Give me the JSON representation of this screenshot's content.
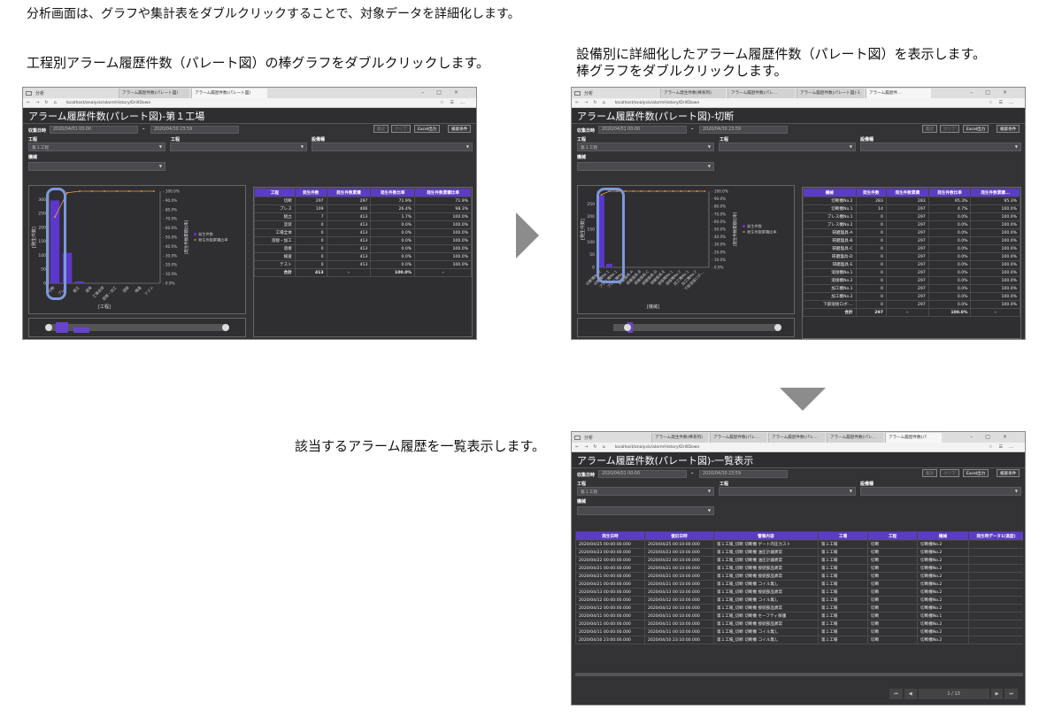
{
  "captions": {
    "top": "分析画面は、グラフや集計表をダブルクリックすることで、対象データを詳細化します。",
    "left": "工程別アラーム履歴件数（パレート図）の棒グラフをダブルクリックします。",
    "right_line1": "設備別に詳細化したアラーム履歴件数（パレート図）を表示します。",
    "right_line2": "棒グラフをダブルクリックします。",
    "bottom": "該当するアラーム履歴を一覧表示します。"
  },
  "browser": {
    "url": "localhost/analysis/alarmHistory/DrillDown",
    "start_label": "分析",
    "tabs1": [
      "アラーム履歴件数(パレート図)",
      "アラーム履歴件数(パレート図)"
    ],
    "tabs2": [
      "アラーム発生件数(棒系列)",
      "アラーム履歴件数(パレ...",
      "アラーム履歴件数(パレート図)-1",
      "アラーム履歴件..."
    ],
    "tabs3": [
      "アラーム発生件数(棒系列)",
      "アラーム履歴件数(パレ...",
      "アラーム履歴件数(パレ...",
      "アラーム履歴件数(パレ...",
      "アラーム履歴件数(パ"
    ]
  },
  "filters": {
    "date_label": "収集日時",
    "date_from": "2020/04/01 00:00",
    "date_to": "2020/04/30 23:59",
    "process_label": "工程",
    "process_value": "第１工程",
    "step_label": "工程",
    "equipment_type_label": "設備種",
    "equipment_label": "機械",
    "buttons": {
      "aggregate": "集計",
      "clear": "クリア",
      "excel": "Excel出力",
      "search": "検索条件"
    }
  },
  "screen1": {
    "title": "アラーム履歴件数(パレート図)-第１工場",
    "xlabel": "[工程]",
    "ylabel": "[発生件数]",
    "right_axis_label": "[発生件数累積比率]",
    "legend": [
      "発生件数",
      "発生件数累積比率"
    ],
    "table_headers": [
      "工程",
      "発生件数",
      "発生件数累積",
      "発生件数比率",
      "発生件数累積比率"
    ],
    "rows": [
      [
        "切断",
        "297",
        "297",
        "71.9%",
        "71.9%"
      ],
      [
        "プレス",
        "109",
        "406",
        "26.4%",
        "98.3%"
      ],
      [
        "組立",
        "7",
        "413",
        "1.7%",
        "100.0%"
      ],
      [
        "塗装",
        "0",
        "413",
        "0.0%",
        "100.0%"
      ],
      [
        "工場全体",
        "0",
        "413",
        "0.0%",
        "100.0%"
      ],
      [
        "溶接・加工",
        "0",
        "413",
        "0.0%",
        "100.0%"
      ],
      [
        "溶接",
        "0",
        "413",
        "0.0%",
        "100.0%"
      ],
      [
        "検査",
        "0",
        "413",
        "0.0%",
        "100.0%"
      ],
      [
        "テスト",
        "0",
        "413",
        "0.0%",
        "100.0%"
      ]
    ],
    "total": [
      "合計",
      "413",
      "-",
      "100.0%",
      "-"
    ]
  },
  "screen2": {
    "title": "アラーム履歴件数(パレート図)-切断",
    "xlabel": "[機械]",
    "ylabel": "[発生件数]",
    "right_axis_label": "[発生件数累積比率]",
    "legend": [
      "発生件数",
      "発生件数累積比率"
    ],
    "table_headers": [
      "機械",
      "発生件数",
      "発生件数累積",
      "発生件数比率",
      "発生件数累積..."
    ],
    "rows": [
      [
        "切断機No.2",
        "283",
        "283",
        "95.3%",
        "95.3%"
      ],
      [
        "切断機No.1",
        "14",
        "297",
        "4.7%",
        "100.0%"
      ],
      [
        "プレス機No.1",
        "0",
        "297",
        "0.0%",
        "100.0%"
      ],
      [
        "プレス機No.2",
        "0",
        "297",
        "0.0%",
        "100.0%"
      ],
      [
        "研磨盤具-A",
        "0",
        "297",
        "0.0%",
        "100.0%"
      ],
      [
        "研磨盤具-B",
        "0",
        "297",
        "0.0%",
        "100.0%"
      ],
      [
        "研磨盤具-C",
        "0",
        "297",
        "0.0%",
        "100.0%"
      ],
      [
        "研磨盤具-D",
        "0",
        "297",
        "0.0%",
        "100.0%"
      ],
      [
        "研磨盤具-E",
        "0",
        "297",
        "0.0%",
        "100.0%"
      ],
      [
        "溶接機No.1",
        "0",
        "297",
        "0.0%",
        "100.0%"
      ],
      [
        "溶接機No.2",
        "0",
        "297",
        "0.0%",
        "100.0%"
      ],
      [
        "加工機No.1",
        "0",
        "297",
        "0.0%",
        "100.0%"
      ],
      [
        "加工機No.2",
        "0",
        "297",
        "0.0%",
        "100.0%"
      ],
      [
        "下部溶接ロボ-...",
        "0",
        "297",
        "0.0%",
        "100.0%"
      ]
    ],
    "total": [
      "合計",
      "297",
      "-",
      "100.0%",
      "-"
    ]
  },
  "screen3": {
    "title": "アラーム履歴件数(パレート図)-一覧表示",
    "table_headers": [
      "発生日時",
      "復旧日時",
      "警報内容",
      "工場",
      "工程",
      "機械",
      "発生時データ1(温度)"
    ],
    "rows": [
      [
        "2020/04/25 00:00:00.000",
        "2020/04/25 00:10:00.000",
        "第１工場_切断 切断機 ゲート内圧カスト",
        "第１工場",
        "切断",
        "切断機No.2"
      ],
      [
        "2020/04/23 00:00:00.000",
        "2020/04/23 00:10:00.000",
        "第１工場_切断 切断機 油圧計器異常",
        "第１工場",
        "切断",
        "切断機No.2"
      ],
      [
        "2020/04/22 00:00:00.000",
        "2020/04/22 00:10:00.000",
        "第１工場_切断 切断機 油圧計器異常",
        "第１工場",
        "切断",
        "切断機No.2"
      ],
      [
        "2020/04/21 00:00:00.000",
        "2020/04/21 00:10:00.000",
        "第１工場_切断 切断機 接続部品異常",
        "第１工場",
        "切断",
        "切断機No.2"
      ],
      [
        "2020/04/21 00:00:00.000",
        "2020/04/21 00:10:00.000",
        "第１工場_切断 切断機 接続部品異常",
        "第１工場",
        "切断",
        "切断機No.2"
      ],
      [
        "2020/04/21 00:00:00.000",
        "2020/04/21 00:10:00.000",
        "第１工場_切断 切断機 コイル無し",
        "第１工場",
        "切断",
        "切断機No.2"
      ],
      [
        "2020/04/13 00:00:00.000",
        "2020/04/13 00:10:00.000",
        "第１工場_切断 切断機 接続部品異常",
        "第１工場",
        "切断",
        "切断機No.2"
      ],
      [
        "2020/04/12 00:00:00.000",
        "2020/04/12 00:10:00.000",
        "第１工場_切断 切断機 コイル無し",
        "第１工場",
        "切断",
        "切断機No.2"
      ],
      [
        "2020/04/12 00:00:00.000",
        "2020/04/12 00:10:00.000",
        "第１工場_切断 切断機 接続部品異常",
        "第１工場",
        "切断",
        "切断機No.2"
      ],
      [
        "2020/04/11 00:00:00.000",
        "2020/04/11 00:10:00.000",
        "第１工場_切断 切断機 セーフティ保護",
        "第１工場",
        "切断",
        "切断機No.1"
      ],
      [
        "2020/04/11 00:00:00.000",
        "2020/04/11 00:10:00.000",
        "第１工場_切断 切断機 接続部品異常",
        "第１工場",
        "切断",
        "切断機No.2"
      ],
      [
        "2020/04/11 00:00:00.000",
        "2020/04/11 00:10:00.000",
        "第１工場_切断 切断機 コイル無し",
        "第１工場",
        "切断",
        "切断機No.2"
      ],
      [
        "2020/04/10 23:00:00.000",
        "2020/04/10 23:10:00.000",
        "第１工場_切断 切断機 コイル無し",
        "第１工場",
        "切断",
        "切断機No.2"
      ]
    ],
    "pager": {
      "first": "⏮",
      "prev": "◀",
      "page": "1 / 13",
      "next": "▶",
      "last": "⏭"
    }
  },
  "chart_data": [
    {
      "type": "bar",
      "title": "",
      "xlabel": "[工程]",
      "ylabel": "[発生件数]",
      "categories": [
        "切断",
        "プレス",
        "組立",
        "塗装",
        "工場全体",
        "溶接・加工",
        "溶接",
        "検査",
        "テスト"
      ],
      "series": [
        {
          "name": "発生件数",
          "type": "bar",
          "values": [
            297,
            109,
            7,
            0,
            0,
            0,
            0,
            0,
            0
          ]
        },
        {
          "name": "発生件数累積比率",
          "type": "line",
          "values": [
            71.9,
            98.3,
            100.0,
            100.0,
            100.0,
            100.0,
            100.0,
            100.0,
            100.0
          ]
        }
      ],
      "ylim": [
        0,
        330
      ],
      "y2lim": [
        0,
        100
      ],
      "grid": false,
      "legend": "right"
    },
    {
      "type": "bar",
      "title": "",
      "xlabel": "[機械]",
      "ylabel": "[発生件数]",
      "categories": [
        "切断機No.2",
        "切断機No.1",
        "プレス機No.1",
        "プレス機No.2",
        "研磨盤具-A",
        "研磨盤具-B",
        "研磨盤具-C",
        "研磨盤具-D",
        "研磨盤具-E",
        "溶接機No.1",
        "溶接機No.2",
        "加工機No.1",
        "加工機No.2",
        "下部溶接ロボ-..."
      ],
      "series": [
        {
          "name": "発生件数",
          "type": "bar",
          "values": [
            283,
            14,
            0,
            0,
            0,
            0,
            0,
            0,
            0,
            0,
            0,
            0,
            0,
            0
          ]
        },
        {
          "name": "発生件数累積比率",
          "type": "line",
          "values": [
            95.3,
            100.0,
            100.0,
            100.0,
            100.0,
            100.0,
            100.0,
            100.0,
            100.0,
            100.0,
            100.0,
            100.0,
            100.0,
            100.0
          ]
        }
      ],
      "ylim": [
        0,
        300
      ],
      "y2lim": [
        0,
        100
      ],
      "grid": false,
      "legend": "right"
    }
  ]
}
